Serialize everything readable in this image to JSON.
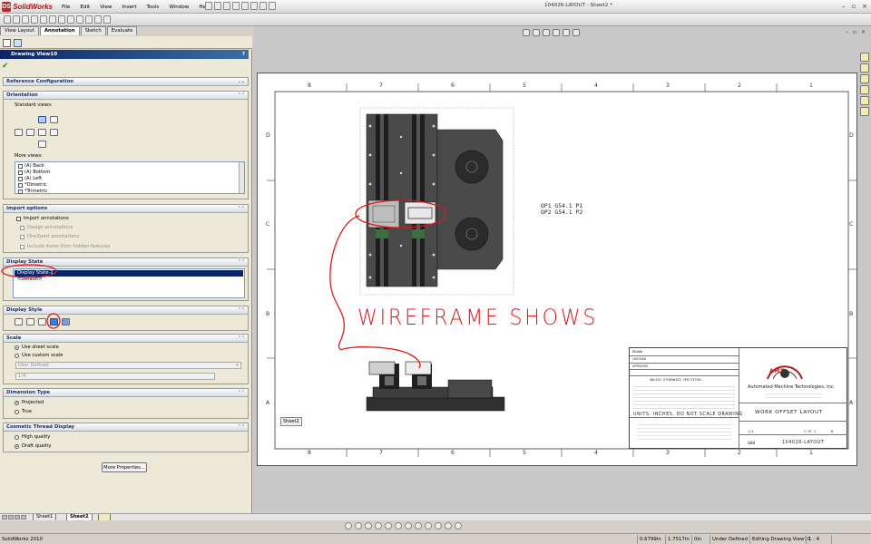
{
  "app": {
    "name": "SolidWorks",
    "logo_letters": "DS",
    "document_title": "104026-LAYOUT - Sheet2 *"
  },
  "menu": [
    "File",
    "Edit",
    "View",
    "Insert",
    "Tools",
    "Window",
    "Help"
  ],
  "command_tabs": [
    "View Layout",
    "Annotation",
    "Sketch",
    "Evaluate"
  ],
  "property_manager": {
    "title": "Drawing View10",
    "help": "?",
    "ok_glyph": "✔",
    "sections": {
      "reference": {
        "title": "Reference Configuration"
      },
      "orientation": {
        "title": "Orientation",
        "standard_views_label": "Standard views:",
        "more_views_label": "More views:",
        "more_views": [
          "(A) Back",
          "(A) Bottom",
          "(A) Left",
          "*Dimetric",
          "*Trimetric"
        ]
      },
      "import": {
        "title": "Import options",
        "import_annotations": "Import annotations",
        "design_annotations": "Design annotations",
        "dimxpert_annotations": "DimXpert annotations",
        "hidden_features": "Include items from hidden features"
      },
      "display_state": {
        "title": "Display State",
        "items": [
          "Display State-1",
          "<Default>"
        ]
      },
      "display_style": {
        "title": "Display Style"
      },
      "scale": {
        "title": "Scale",
        "sheet": "Use sheet scale",
        "custom": "Use custom scale",
        "user_defined": "User Defined",
        "value": "1:4"
      },
      "dimension_type": {
        "title": "Dimension Type",
        "projected": "Projected",
        "true": "True"
      },
      "cosmetic_thread": {
        "title": "Cosmetic Thread Display",
        "high": "High quality",
        "draft": "Draft quality"
      }
    },
    "more_properties": "More Properties..."
  },
  "sheet": {
    "zones_top": [
      "8",
      "7",
      "6",
      "5",
      "4",
      "3",
      "2",
      "1"
    ],
    "zones_side": [
      "D",
      "C",
      "B",
      "A"
    ],
    "op_notes": [
      "OP1 G54.1 P1",
      "OP2 G54.1 P2"
    ],
    "annotation_text": "WIREFRAME SHOWS",
    "annotation_color": "#e01818",
    "sheet_chip": "Sheet2",
    "title_block": {
      "company": "Automated Machine Technologies, Inc.",
      "logo_text": "AMT",
      "title": "WORK OFFSET LAYOUT",
      "dwg_no": "104026-LAYOUT",
      "units_note": "UNITS: INCHES, DO NOT SCALE DRAWING",
      "sheet": "2 OF 2",
      "scale": "1:4",
      "rev": "B",
      "size": "000",
      "unless_note": "UNLESS OTHERWISE SPECIFIED:",
      "drawn": "DRAWN",
      "checked": "CHECKED",
      "approved": "APPROVED"
    }
  },
  "sheet_tabs": [
    "Sheet1",
    "Sheet2"
  ],
  "status_bar": {
    "product": "SolidWorks 2010",
    "x": "0.6799in",
    "y": "1.7517in",
    "z": "0in",
    "state": "Under Defined",
    "editing": "Editing Drawing View10",
    "scale": "1 : 4"
  }
}
